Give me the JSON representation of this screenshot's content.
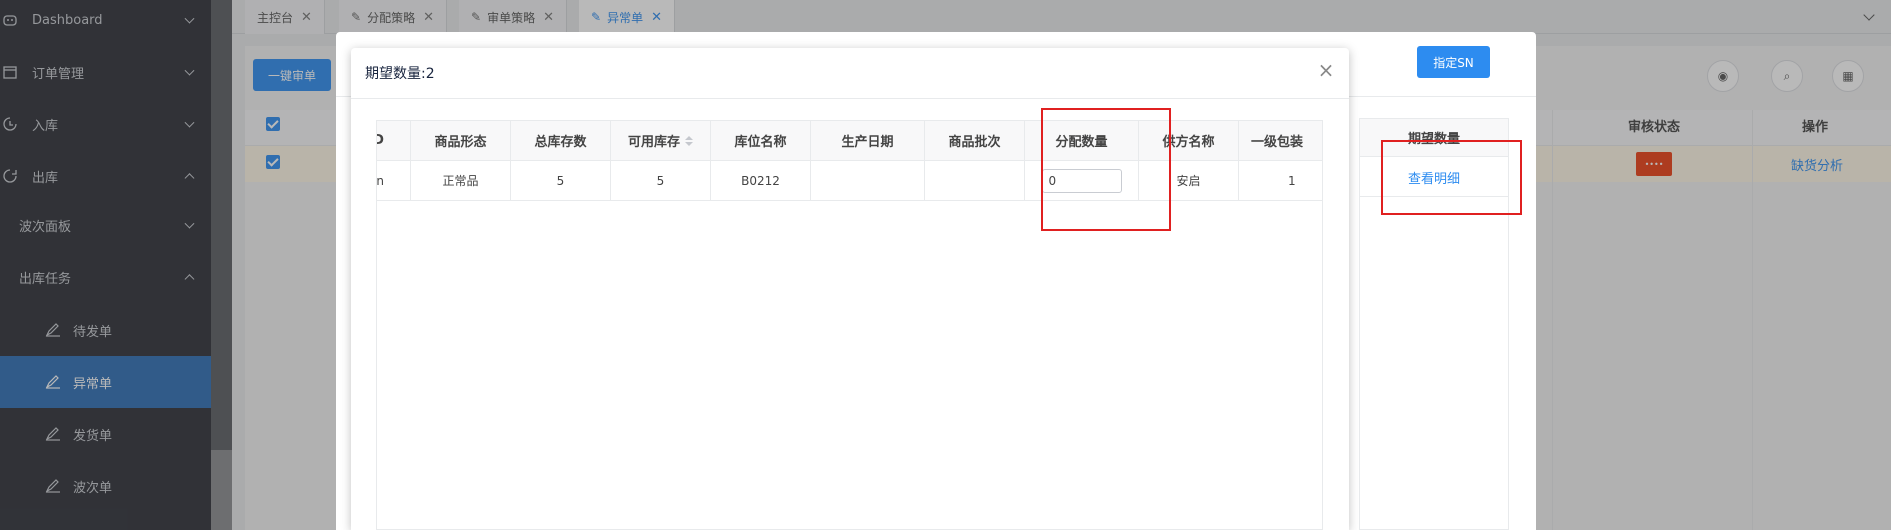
{
  "sidebar": {
    "items": [
      {
        "label": "Dashboard",
        "icon": "dashboard-icon"
      },
      {
        "label": "订单管理",
        "icon": "calendar-icon"
      },
      {
        "label": "入库",
        "icon": "inbound-icon"
      },
      {
        "label": "出库",
        "icon": "outbound-icon"
      },
      {
        "label": "波次面板"
      },
      {
        "label": "出库任务"
      },
      {
        "label": "待发单",
        "icon": "edit-icon"
      },
      {
        "label": "异常单",
        "icon": "edit-icon"
      },
      {
        "label": "发货单",
        "icon": "edit-icon"
      },
      {
        "label": "波次单",
        "icon": "edit-icon"
      }
    ]
  },
  "tabs": [
    {
      "label": "主控台"
    },
    {
      "label": "分配策略"
    },
    {
      "label": "审单策略"
    },
    {
      "label": "异常单"
    }
  ],
  "background": {
    "bulk_review_label": "一键审单",
    "col_review_status": "审核状态",
    "col_action": "操作",
    "action_link": "缺货分析",
    "status_tag": "••••"
  },
  "outer_modal": {
    "assign_sn_label": "指定SN",
    "side_table_header": "期望数量",
    "view_detail_label": "查看明细"
  },
  "inner_modal": {
    "title": "期望数量:2",
    "close_symbol": "×",
    "table": {
      "headers": [
        "D",
        "商品形态",
        "总库存数",
        "可用库存",
        "库位名称",
        "生产日期",
        "商品批次",
        "分配数量",
        "供方名称",
        "一级包装"
      ],
      "row": {
        "c0": "in",
        "form": "正常品",
        "total_stock": "5",
        "available_stock": "5",
        "location": "B0212",
        "production_date": "",
        "batch": "",
        "allocate_qty": "0",
        "supplier": "安启",
        "pack_level1": "1"
      }
    }
  },
  "colors": {
    "accent": "#2d8cf0",
    "sidebar_bg": "#2e3138",
    "sidebar_active": "#2f6fb5",
    "highlight_box": "#e02020"
  }
}
